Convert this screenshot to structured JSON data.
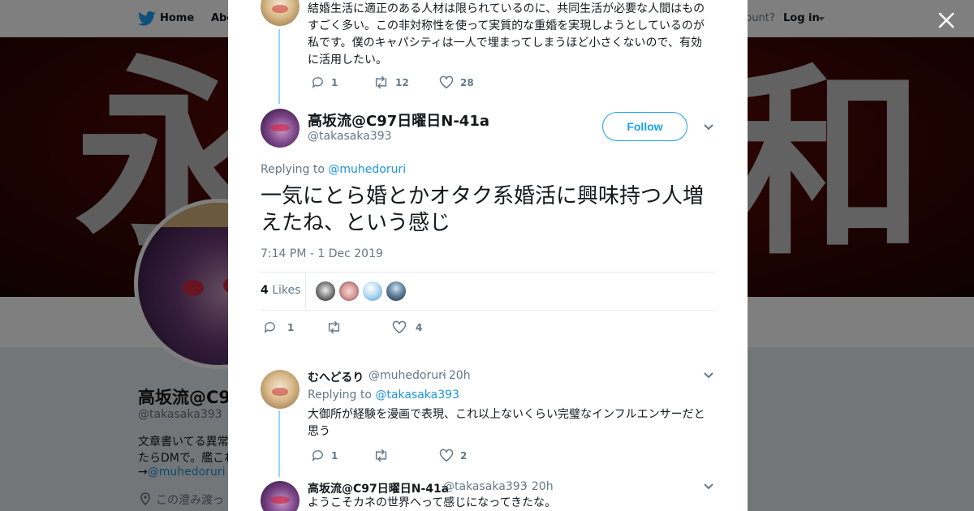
{
  "background": {
    "nav": {
      "home": "Home",
      "about": "Abo",
      "account": "ccount?",
      "login": "Log in"
    },
    "banner": {
      "kanji_left": "永",
      "kanji_right": "和"
    },
    "profile": {
      "name": "高坂流@C9",
      "handle": "@takasaka393",
      "bio_line1": "文章書いてる異常",
      "bio_line2": "たらDMで。艦これ",
      "bio_line3_prefix": "→",
      "bio_line3_link": "@muhedoruri",
      "location": "この澄み渡っ"
    }
  },
  "parent_tweet": {
    "text": "結婚生活に適正のある人材は限られているのに、共同生活が必要な人間はものすごく多い。この非対称性を使って実質的な重婚を実現しようとしているのが私です。僕のキャパシティは一人で埋まってしまうほど小さくないので、有効に活用したい。",
    "replies": "1",
    "retweets": "12",
    "likes": "28"
  },
  "main_tweet": {
    "name": "高坂流@C97日曜日N-41a",
    "handle": "@takasaka393",
    "follow_label": "Follow",
    "replying_prefix": "Replying to",
    "replying_to": "@muhedoruri",
    "text": "一気にとら婚とかオタク系婚活に興味持つ人増えたね、という感じ",
    "timestamp": "7:14 PM - 1 Dec 2019",
    "likes_count": "4",
    "likes_label": "Likes",
    "replies": "1",
    "retweets": "",
    "likes": "4"
  },
  "replies": [
    {
      "name": "むへどるり",
      "handle": "@muhedoruri",
      "time": "· 20h",
      "replying_prefix": "Replying to",
      "replying_to": "@takasaka393",
      "text": "大御所が経験を漫画で表現、これ以上ないくらい完璧なインフルエンサーだと思う",
      "replies": "1",
      "retweets": "",
      "likes": "2"
    },
    {
      "name": "高坂流@C97日曜日N-41a",
      "handle": "@takasaka393",
      "time": "· 20h",
      "text": "ようこそカネの世界へって感じになってきたな。"
    }
  ]
}
